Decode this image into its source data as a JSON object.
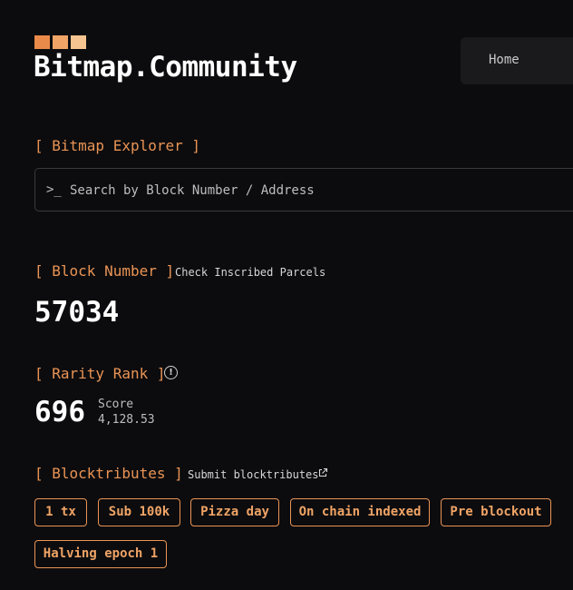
{
  "header": {
    "site_title": "Bitmap.Community",
    "nav": {
      "home": "Home"
    }
  },
  "explorer": {
    "label": "[ Bitmap Explorer ]",
    "search_prompt": ">_",
    "search_placeholder": "Search by Block Number / Address",
    "search_value": ""
  },
  "block": {
    "label": "[ Block Number ]",
    "link": "Check Inscribed Parcels",
    "number": "57034"
  },
  "rarity": {
    "label": "[ Rarity Rank ]",
    "rank": "696",
    "score_label": "Score",
    "score_value": "4,128.53"
  },
  "blocktributes": {
    "label": "[ Blocktributes ]",
    "submit_link": "Submit blocktributes",
    "tags": [
      "1 tx",
      "Sub 100k",
      "Pizza day",
      "On chain indexed",
      "Pre blockout",
      "Halving epoch 1"
    ]
  },
  "colors": {
    "accent": "#ea9455",
    "logo_squares": [
      "#ea8a4a",
      "#f0a466",
      "#f6c490"
    ],
    "background": "#0c0c0e"
  }
}
